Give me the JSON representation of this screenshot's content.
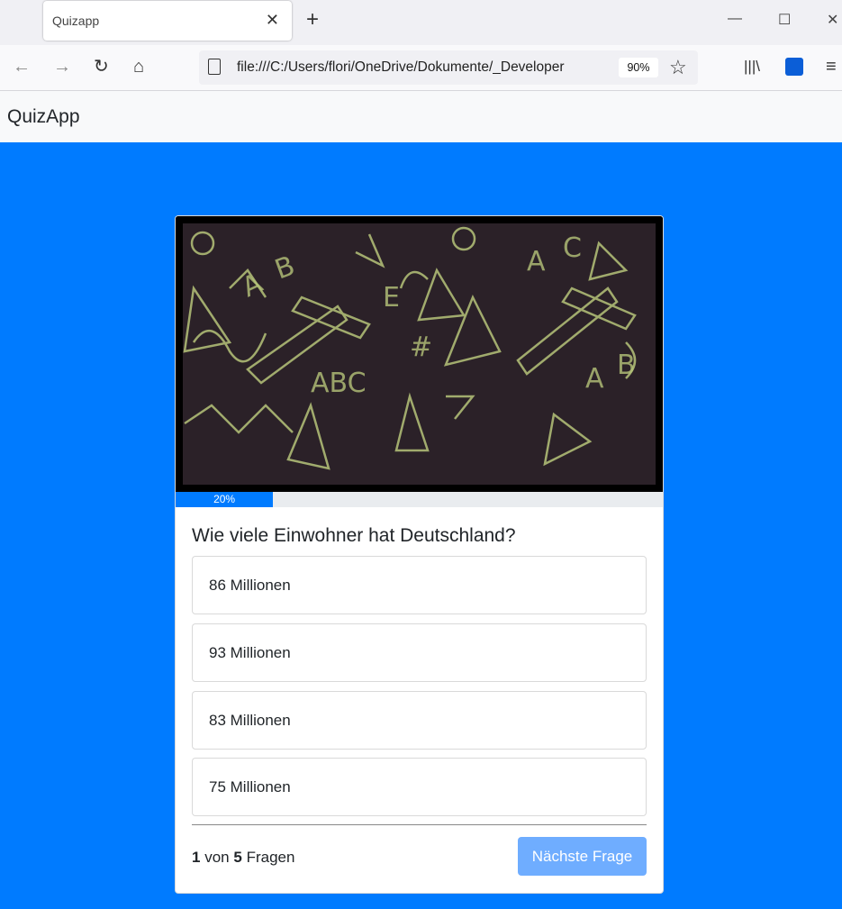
{
  "browser": {
    "tab_title": "Quizapp",
    "url": "file:///C:/Users/flori/OneDrive/Dokumente/_Developer",
    "zoom": "90%"
  },
  "app": {
    "brand": "QuizApp"
  },
  "quiz": {
    "progress_label": "20%",
    "progress_fraction": 0.2,
    "question": "Wie viele Einwohner hat Deutschland?",
    "answers": [
      "86 Millionen",
      "93 Millionen",
      "83 Millionen",
      "75 Millionen"
    ],
    "counter": {
      "current": "1",
      "sep": "von",
      "total": "5",
      "suffix": "Fragen"
    },
    "next_label": "Nächste Frage"
  },
  "colors": {
    "accent": "#007bff",
    "button_disabled": "#6fadff"
  }
}
